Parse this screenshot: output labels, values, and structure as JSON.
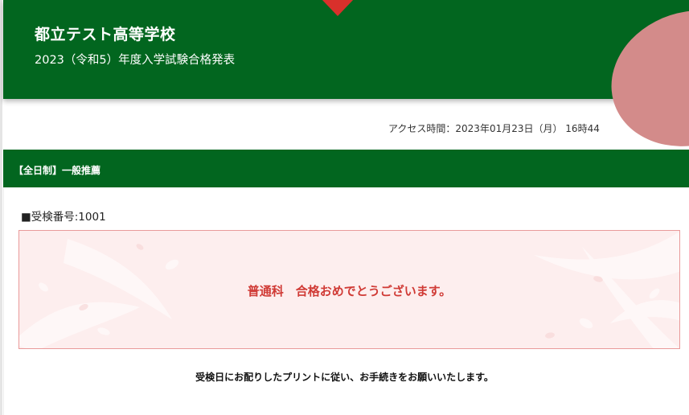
{
  "header": {
    "school_name": "都立テスト高等学校",
    "exam_title": "2023（令和5）年度入学試験合格発表"
  },
  "access": {
    "text": "アクセス時間：2023年01月23日（月） 16時44"
  },
  "section": {
    "label": "【全日制】一般推薦"
  },
  "result": {
    "exam_number": "■受検番号:1001",
    "message": "普通科　合格おめでとうございます。"
  },
  "instruction": {
    "text": "受検日にお配りしたプリントに従い、お手続きをお願いいたします。"
  },
  "colors": {
    "header_green": "#02661f",
    "accent_red": "#d03a35",
    "result_bg": "#fdeeee",
    "result_border": "#e99a9a",
    "decor_pink": "#d38b8a"
  }
}
